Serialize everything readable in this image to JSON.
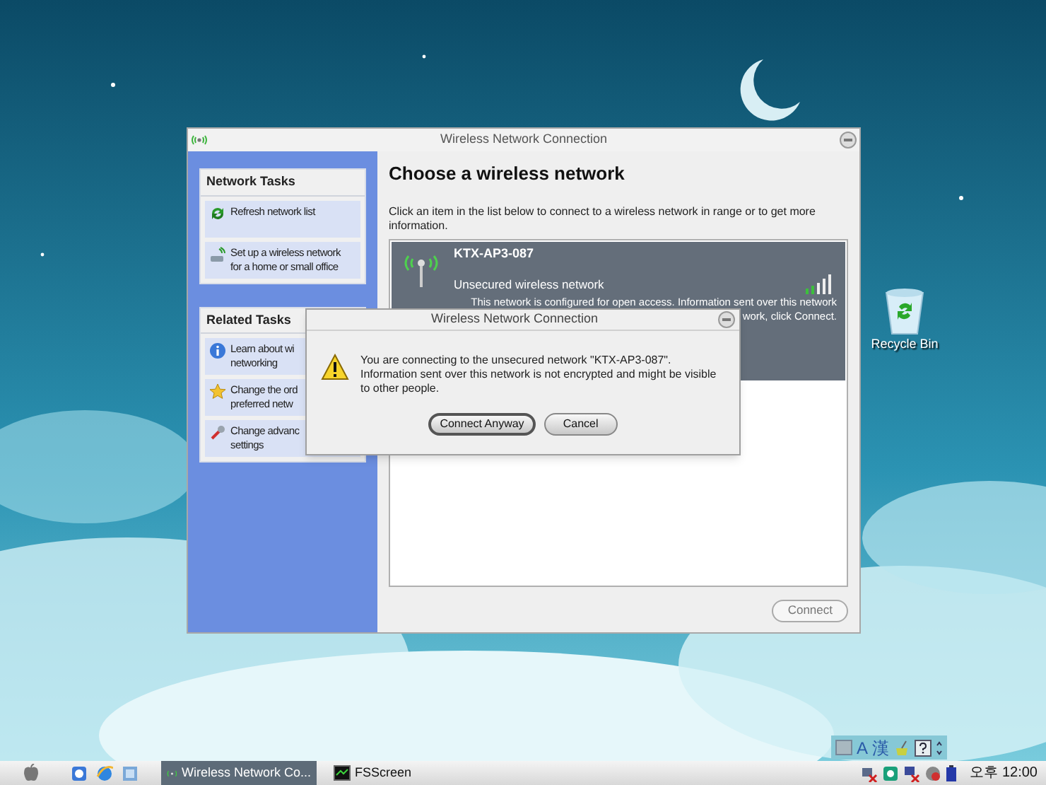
{
  "desktop": {
    "icons": [
      {
        "label": "Recycle Bin"
      }
    ]
  },
  "window": {
    "title": "Wireless Network Connection",
    "task_groups": [
      {
        "title": "Network Tasks",
        "items": [
          {
            "lines": [
              "Refresh network list"
            ]
          },
          {
            "lines": [
              "Set up a wireless network",
              "for a home or small office"
            ]
          }
        ]
      },
      {
        "title": "Related Tasks",
        "items": [
          {
            "lines": [
              "Learn about wi",
              "networking"
            ]
          },
          {
            "lines": [
              "Change the ord",
              "preferred netw"
            ]
          },
          {
            "lines": [
              "Change advanc",
              "settings"
            ]
          }
        ]
      }
    ],
    "heading": "Choose a wireless network",
    "instruction": "Click an item in the list below to connect to a wireless network in range or to get more information.",
    "networks": [
      {
        "name": "KTX-AP3-087",
        "security": "Unsecured wireless network",
        "description": [
          "This network is configured for open access. Information sent over this network",
          "work, click Connect."
        ],
        "selected": true
      }
    ],
    "connect_button": "Connect"
  },
  "dialog": {
    "title": "Wireless Network Connection",
    "message": "You are connecting to the unsecured network \"KTX-AP3-087\". Information sent over this network is not encrypted and might be visible to other people.",
    "buttons": [
      {
        "label": "Connect Anyway",
        "selected": true
      },
      {
        "label": "Cancel",
        "selected": false
      }
    ]
  },
  "language_bar": [
    "A",
    "漢"
  ],
  "taskbar": {
    "tasks": [
      {
        "label": "Wireless Network Co...",
        "selected": true
      },
      {
        "label": "FSScreen",
        "selected": false
      }
    ],
    "clock": "오후 12:00"
  }
}
